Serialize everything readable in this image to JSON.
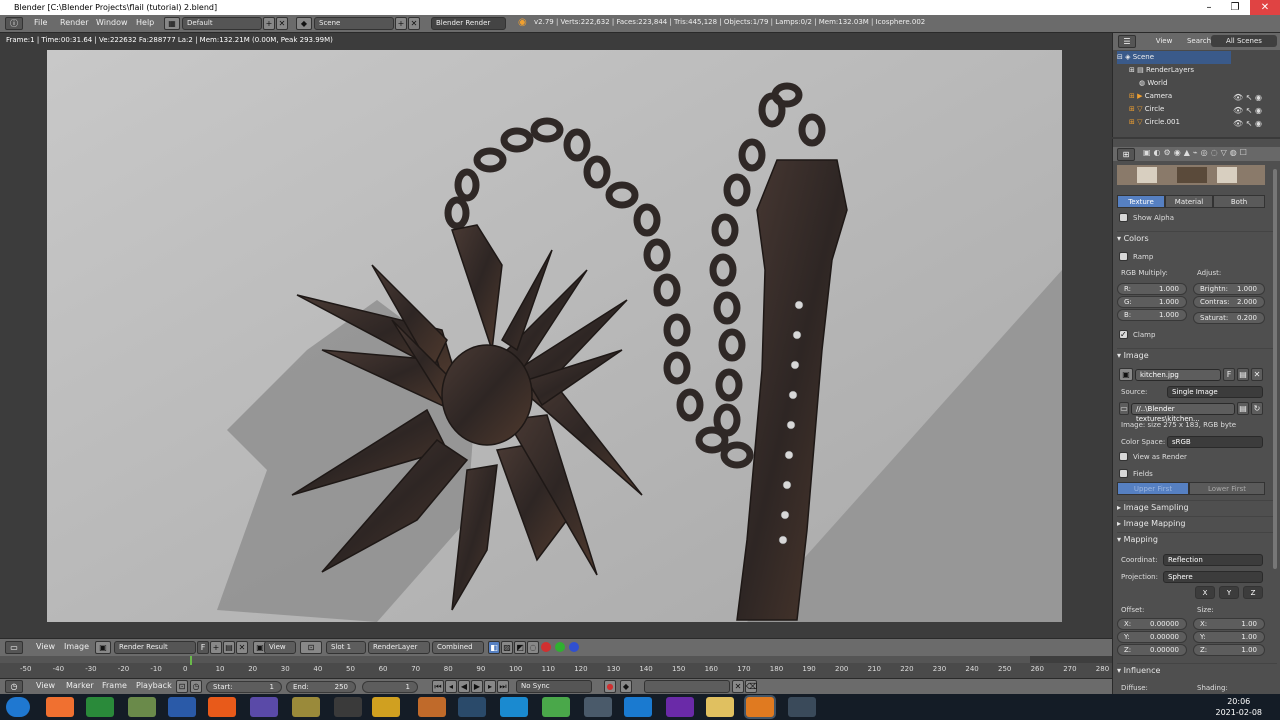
{
  "window": {
    "title": "Blender [C:\\Blender Projects\\flail (tutorial) 2.blend]",
    "min": "–",
    "max": "❐",
    "close": "✕"
  },
  "menu": {
    "items": [
      "File",
      "Render",
      "Window",
      "Help"
    ],
    "layout": "Default",
    "scene": "Scene",
    "engine": "Blender Render",
    "stats": "v2.79 | Verts:222,632 | Faces:223,844 | Tris:445,128 | Objects:1/79 | Lamps:0/2 | Mem:132.03M | Icosphere.002"
  },
  "viewport": {
    "frame_info": "Frame:1 | Time:00:31.64 | Ve:222632 Fa:288777 La:2 | Mem:132.21M (0.00M, Peak 293.99M)"
  },
  "outliner": {
    "tabs": [
      "View",
      "Search",
      "All Scenes"
    ],
    "rows": [
      "Scene",
      "RenderLayers",
      "World",
      "Camera",
      "Circle",
      "Circle.001"
    ]
  },
  "props": {
    "tabs": [
      "Texture",
      "Material",
      "Both"
    ],
    "show_alpha": "Show Alpha",
    "colors": {
      "title": "Colors",
      "ramp": "Ramp",
      "rgb_label": "RGB Multiply:",
      "adjust_label": "Adjust:",
      "r_label": "R:",
      "r": "1.000",
      "g_label": "G:",
      "g": "1.000",
      "b_label": "B:",
      "b": "1.000",
      "bright_label": "Brightn:",
      "bright": "1.000",
      "contrast_label": "Contras:",
      "contrast": "2.000",
      "sat_label": "Saturat:",
      "sat": "0.200",
      "clamp": "Clamp"
    },
    "image": {
      "title": "Image",
      "file": "kitchen.jpg",
      "f": "F",
      "source_label": "Source:",
      "source": "Single Image",
      "path": "//..\\Blender textures\\kitchen...",
      "info": "Image: size 275 x 183, RGB byte",
      "colorspace_label": "Color Space:",
      "colorspace": "sRGB",
      "view_as_render": "View as Render",
      "fields": "Fields",
      "upper": "Upper First",
      "lower": "Lower First"
    },
    "sampling": "Image Sampling",
    "img_mapping": "Image Mapping",
    "mapping": {
      "title": "Mapping",
      "coord_label": "Coordinat:",
      "coord": "Reflection",
      "proj_label": "Projection:",
      "proj": "Sphere",
      "axes": [
        "X",
        "Y",
        "Z"
      ],
      "offset_label": "Offset:",
      "size_label": "Size:",
      "ox_label": "X:",
      "ox": "0.00000",
      "oy_label": "Y:",
      "oy": "0.00000",
      "oz_label": "Z:",
      "oz": "0.00000",
      "sx_label": "X:",
      "sx": "1.00",
      "sy_label": "Y:",
      "sy": "1.00",
      "sz_label": "Z:",
      "sz": "1.00"
    },
    "influence": "Influence",
    "diffuse": "Diffuse:",
    "shading": "Shading:"
  },
  "image_editor": {
    "view": "View",
    "image": "Image",
    "render_result": "Render Result",
    "f": "F",
    "view2": "View",
    "slot": "Slot 1",
    "layer": "RenderLayer",
    "pass": "Combined"
  },
  "timeline": {
    "ticks": [
      "-50",
      "-40",
      "-30",
      "-20",
      "-10",
      "0",
      "10",
      "20",
      "30",
      "40",
      "50",
      "60",
      "70",
      "80",
      "90",
      "100",
      "110",
      "120",
      "130",
      "140",
      "150",
      "160",
      "170",
      "180",
      "190",
      "200",
      "210",
      "220",
      "230",
      "240",
      "250",
      "260",
      "270",
      "280"
    ],
    "menus": [
      "View",
      "Marker",
      "Frame",
      "Playback"
    ],
    "start_label": "Start:",
    "start": "1",
    "end_label": "End:",
    "end": "250",
    "current": "1",
    "sync": "No Sync"
  },
  "taskbar": {
    "time": "20:06",
    "date": "2021-02-08"
  }
}
